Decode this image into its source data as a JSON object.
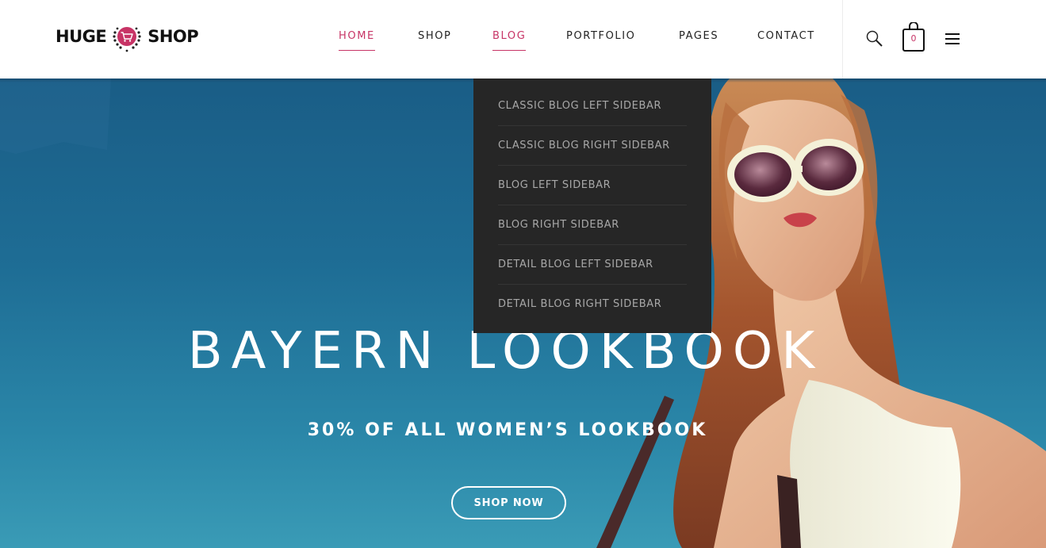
{
  "logo": {
    "left": "HUGE",
    "right": "SHOP",
    "badge_icon": "shopping-cart-icon",
    "accent": "#c73466"
  },
  "nav": [
    {
      "label": "HOME",
      "active": true
    },
    {
      "label": "SHOP",
      "active": false
    },
    {
      "label": "BLOG",
      "active": true
    },
    {
      "label": "PORTFOLIO",
      "active": false
    },
    {
      "label": "PAGES",
      "active": false
    },
    {
      "label": "CONTACT",
      "active": false
    }
  ],
  "header_icons": {
    "search": "search-icon",
    "cart": "shopping-bag-icon",
    "cart_count": "0",
    "menu": "hamburger-menu-icon"
  },
  "blog_dropdown": [
    "CLASSIC BLOG LEFT SIDEBAR",
    "CLASSIC BLOG RIGHT SIDEBAR",
    "BLOG LEFT SIDEBAR",
    "BLOG RIGHT SIDEBAR",
    "DETAIL BLOG LEFT SIDEBAR",
    "DETAIL BLOG RIGHT SIDEBAR"
  ],
  "hero": {
    "title": "BAYERN LOOKBOOK",
    "subtitle": "30% OF ALL WOMEN’S LOOKBOOK",
    "button": "SHOP NOW"
  },
  "colors": {
    "accent": "#c73466",
    "dropdown_bg": "#262626",
    "sky": "#1d6a8e"
  }
}
